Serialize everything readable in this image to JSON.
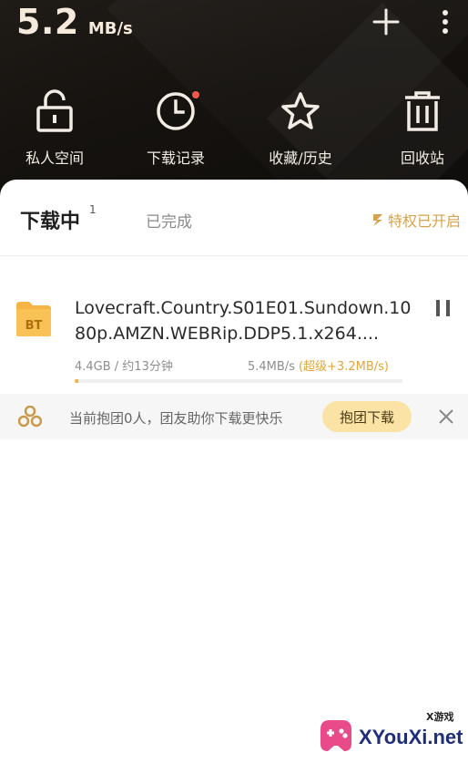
{
  "header": {
    "speed_value": "5.2",
    "speed_unit": "MB/s",
    "add_icon": "plus-icon",
    "more_icon": "more-vertical-icon",
    "quick_actions": [
      {
        "label": "私人空间",
        "icon": "unlock-icon"
      },
      {
        "label": "下载记录",
        "icon": "clock-icon",
        "has_red_dot": true
      },
      {
        "label": "收藏/历史",
        "icon": "star-icon"
      },
      {
        "label": "回收站",
        "icon": "trash-icon"
      }
    ]
  },
  "tabs": {
    "downloading_label": "下载中",
    "downloading_count": "1",
    "completed_label": "已完成",
    "privilege_label": "特权已开启"
  },
  "download": {
    "file_type": "BT",
    "file_name": "Lovecraft.Country.S01E01.Sundown.1080p.AMZN.WEBRip.DDP5.1.x264....",
    "size_eta": "4.4GB / 约13分钟",
    "speed": "5.4MB/s",
    "boost": "(超级+3.2MB/s)",
    "progress": 0.01
  },
  "team": {
    "text": "当前抱团0人，团友助你下载更快乐",
    "button_label": "抱团下载"
  },
  "watermark": {
    "small": "X游戏",
    "big": "XYouXi.net"
  },
  "colors": {
    "header_bg": "#15120f",
    "accent_gold": "#e0a63d",
    "team_button": "#fbe2a5",
    "red_dot": "#f05a4d"
  }
}
